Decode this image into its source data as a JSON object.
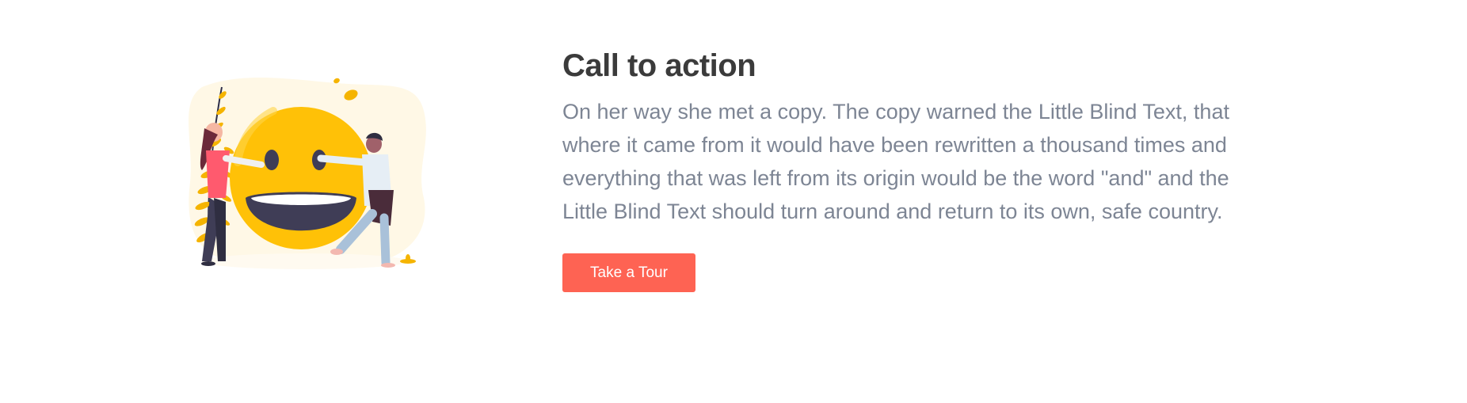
{
  "cta": {
    "title": "Call to action",
    "description": "On her way she met a copy. The copy warned the Little Blind Text, that where it came from it would have been rewritten a thousand times and everything that was left from its origin would be the word \"and\" and the Little Blind Text should turn around and return to its own, safe country.",
    "button_label": "Take a Tour",
    "illustration_icon": "smiley-hug-illustration"
  },
  "colors": {
    "title": "#3b3b3b",
    "text": "#7d8594",
    "button": "#fe6353",
    "smiley": "#ffc107",
    "blob": "#fff8e6"
  }
}
